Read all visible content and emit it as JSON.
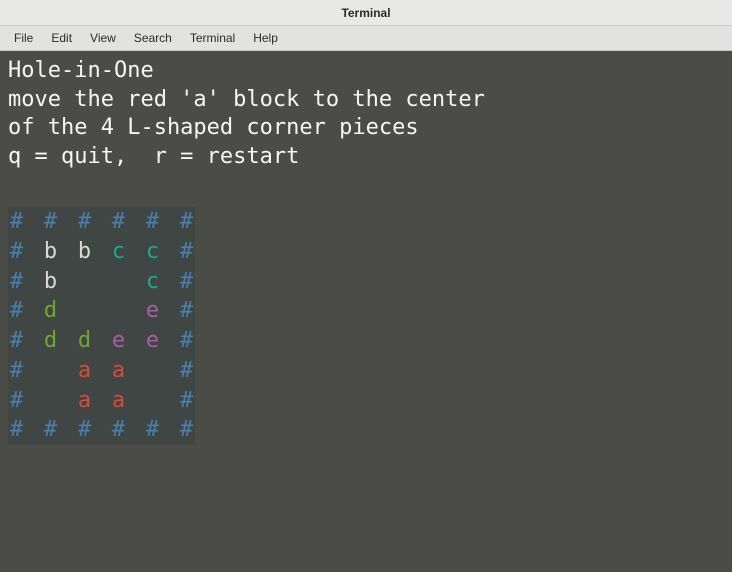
{
  "window": {
    "title": "Terminal"
  },
  "menu": {
    "file": "File",
    "edit": "Edit",
    "view": "View",
    "search": "Search",
    "terminal": "Terminal",
    "help": "Help"
  },
  "game": {
    "title": "Hole-in-One",
    "instructions_line1": "move the red 'a' block to the center",
    "instructions_line2": "of the 4 L-shaped corner pieces",
    "controls": "q = quit,  r = restart"
  },
  "board": {
    "grid": [
      [
        "#",
        "#",
        "#",
        "#",
        "#",
        "#"
      ],
      [
        "#",
        "b",
        "b",
        "c",
        "c",
        "#"
      ],
      [
        "#",
        "b",
        " ",
        " ",
        "c",
        "#"
      ],
      [
        "#",
        "d",
        " ",
        " ",
        "e",
        "#"
      ],
      [
        "#",
        "d",
        "d",
        "e",
        "e",
        "#"
      ],
      [
        "#",
        " ",
        "a",
        "a",
        " ",
        "#"
      ],
      [
        "#",
        " ",
        "a",
        "a",
        " ",
        "#"
      ],
      [
        "#",
        "#",
        "#",
        "#",
        "#",
        "#"
      ]
    ],
    "colors": {
      "#": "c-wall",
      "b": "c-b",
      "c": "c-c",
      "d": "c-d",
      "e": "c-e",
      "a": "c-a",
      " ": "c-empty"
    }
  }
}
